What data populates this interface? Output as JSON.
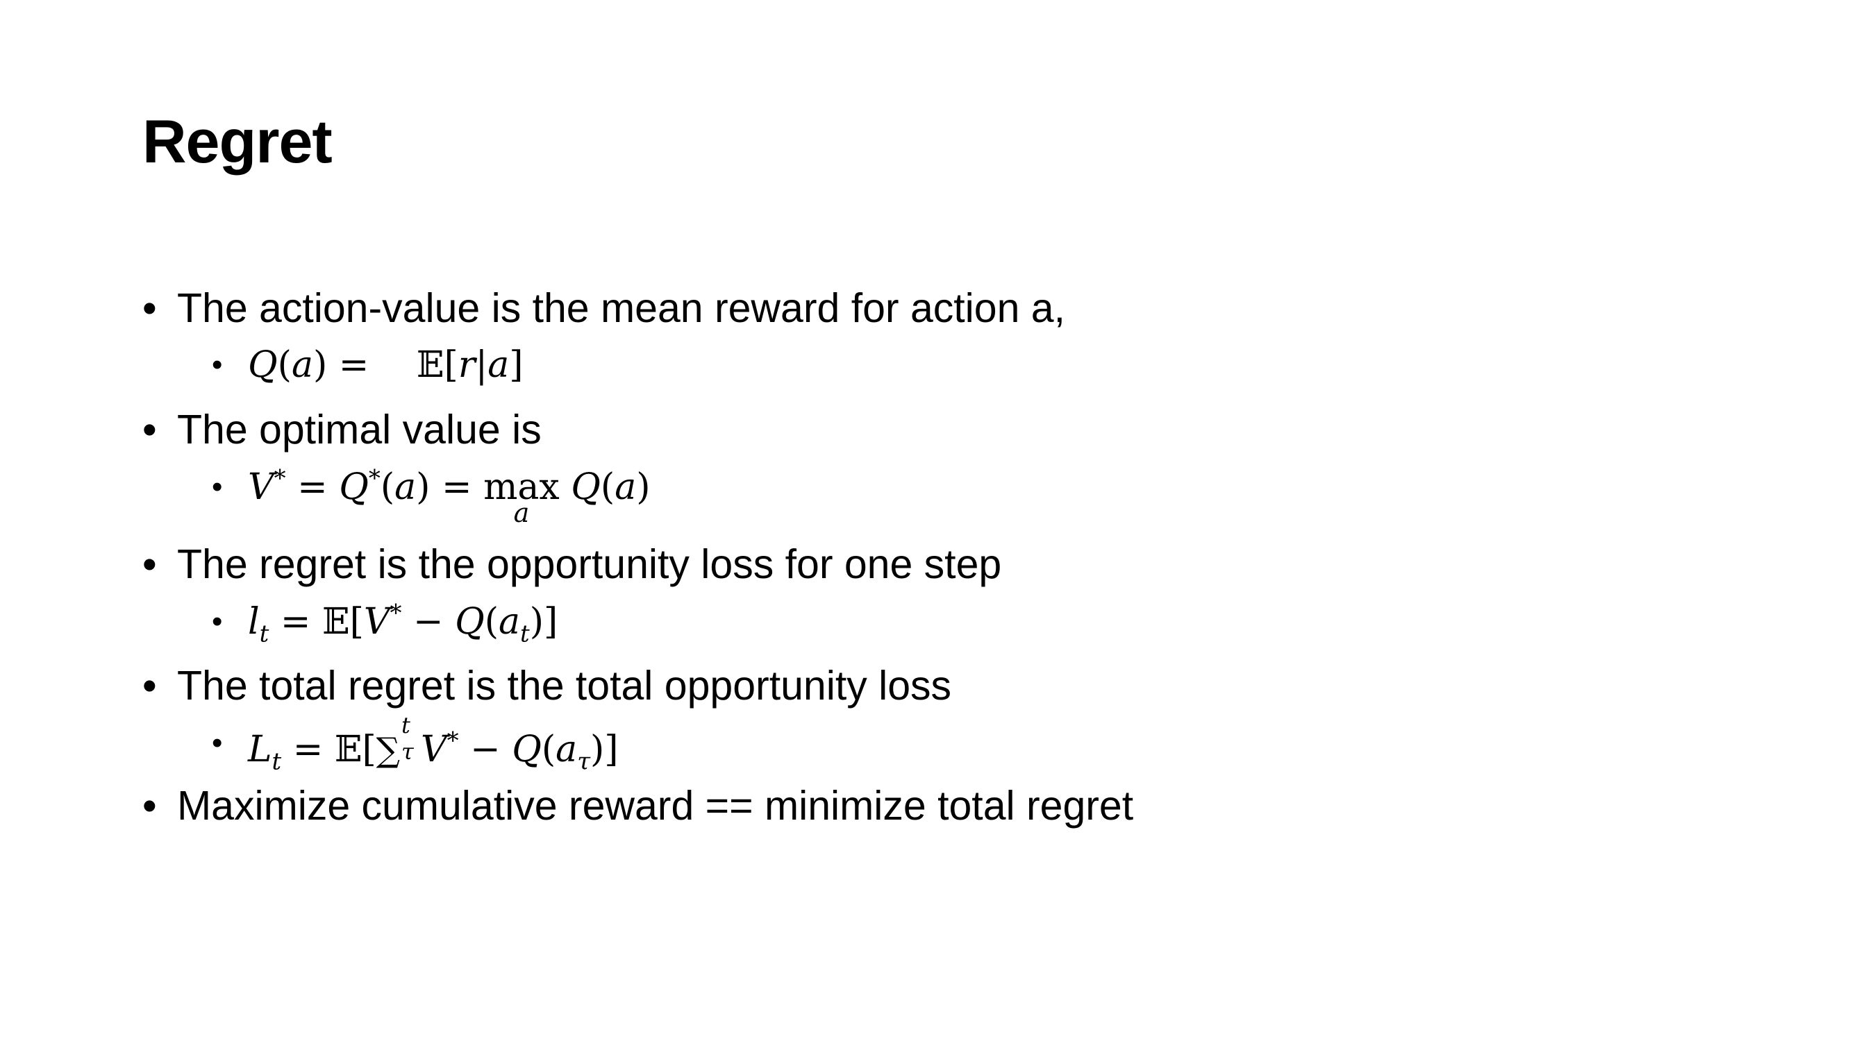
{
  "slide": {
    "title": "Regret",
    "bullets": [
      {
        "text": "The action-value is the mean reward for action a,",
        "formula": "Q(a) = 𝔼[r|a]"
      },
      {
        "text": "The optimal value is",
        "formula": "V* = Q*(a) = max_a Q(a)"
      },
      {
        "text": "The regret is the opportunity loss for one step",
        "formula": "l_t = 𝔼[V* − Q(a_t)]"
      },
      {
        "text": "The total regret is the total opportunity loss",
        "formula": "L_t = 𝔼[∑_τ^t V* − Q(a_τ)]"
      },
      {
        "text": "Maximize cumulative reward ==  minimize total regret"
      }
    ],
    "bullet_symbol": "•"
  }
}
